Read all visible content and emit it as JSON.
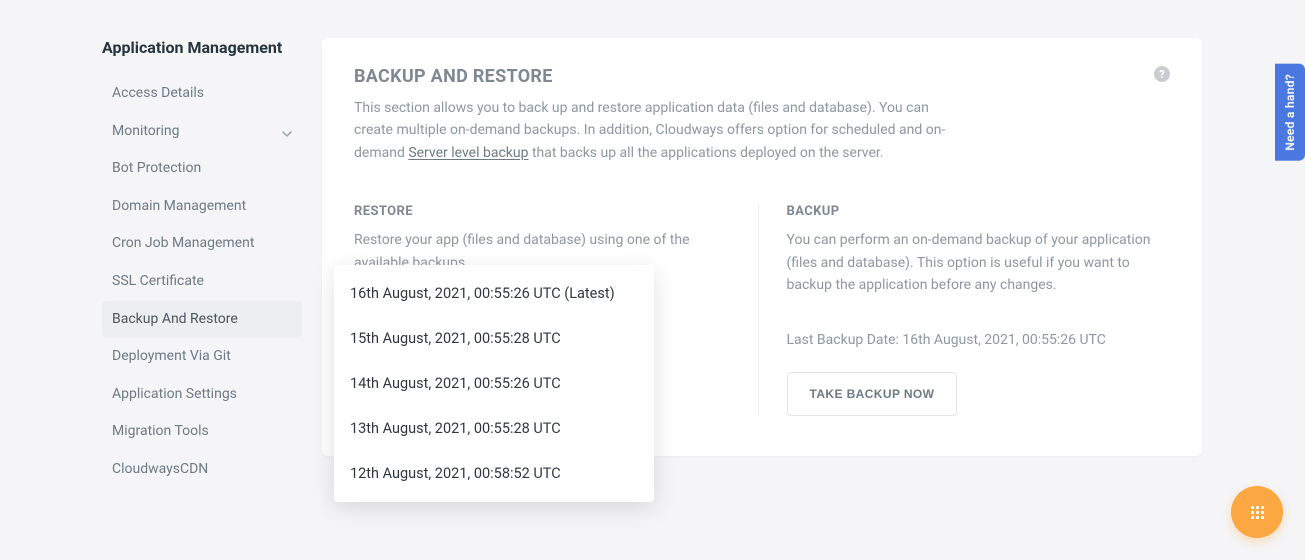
{
  "sidebar": {
    "title": "Application Management",
    "items": [
      {
        "label": "Access Details",
        "active": false,
        "expandable": false
      },
      {
        "label": "Monitoring",
        "active": false,
        "expandable": true
      },
      {
        "label": "Bot Protection",
        "active": false,
        "expandable": false
      },
      {
        "label": "Domain Management",
        "active": false,
        "expandable": false
      },
      {
        "label": "Cron Job Management",
        "active": false,
        "expandable": false
      },
      {
        "label": "SSL Certificate",
        "active": false,
        "expandable": false
      },
      {
        "label": "Backup And Restore",
        "active": true,
        "expandable": false
      },
      {
        "label": "Deployment Via Git",
        "active": false,
        "expandable": false
      },
      {
        "label": "Application Settings",
        "active": false,
        "expandable": false
      },
      {
        "label": "Migration Tools",
        "active": false,
        "expandable": false
      },
      {
        "label": "CloudwaysCDN",
        "active": false,
        "expandable": false
      }
    ]
  },
  "main": {
    "title": "BACKUP AND RESTORE",
    "desc_pre": "This section allows you to back up and restore application data (files and database). You can create multiple on-demand backups. In addition, Cloudways offers option for scheduled and on-demand ",
    "desc_link": "Server level backup",
    "desc_post": " that backs up all the applications deployed on the server.",
    "restore": {
      "title": "RESTORE",
      "desc": "Restore your app (files and database) using one of the available backups."
    },
    "backup": {
      "title": "BACKUP",
      "desc": "You can perform an on-demand backup of your application (files and database). This option is useful if you want to backup the application before any changes.",
      "last_backup_label": "Last Backup Date: ",
      "last_backup_value": "16th August, 2021, 00:55:26 UTC",
      "button": "TAKE BACKUP NOW"
    }
  },
  "dropdown": {
    "options": [
      "16th August, 2021, 00:55:26 UTC (Latest)",
      "15th August, 2021, 00:55:28 UTC",
      "14th August, 2021, 00:55:26 UTC",
      "13th August, 2021, 00:55:28 UTC",
      "12th August, 2021, 00:58:52 UTC"
    ]
  },
  "help_tab": "Need a hand?",
  "help_icon_glyph": "?"
}
